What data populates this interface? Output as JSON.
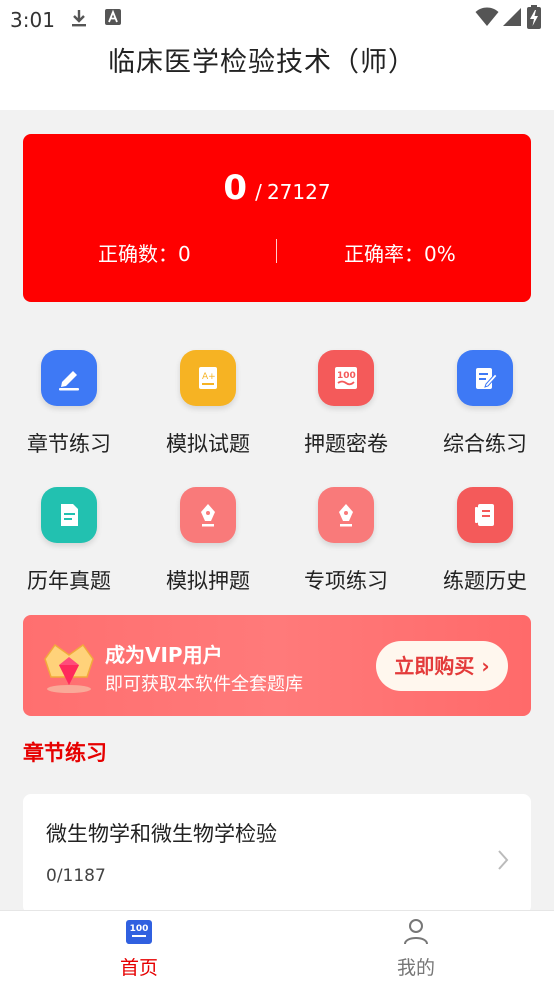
{
  "status_bar": {
    "time": "3:01"
  },
  "app_title": "临床医学检验技术（师）",
  "stats": {
    "done": "0",
    "separator": "/",
    "total": "27127",
    "correct_count_label": "正确数：0",
    "correct_rate_label": "正确率：0%"
  },
  "menu": [
    {
      "label": "章节练习",
      "icon": "pencil-ruler-icon",
      "color": "#3e79f5"
    },
    {
      "label": "模拟试题",
      "icon": "exam-paper-icon",
      "color": "#f6b323"
    },
    {
      "label": "押题密卷",
      "icon": "score-100-icon",
      "color": "#f45a5a"
    },
    {
      "label": "综合练习",
      "icon": "document-edit-icon",
      "color": "#3e79f5"
    },
    {
      "label": "历年真题",
      "icon": "document-icon",
      "color": "#22c1b0"
    },
    {
      "label": "模拟押题",
      "icon": "pen-nib-icon",
      "color": "#f97a7a"
    },
    {
      "label": "专项练习",
      "icon": "pen-nib-icon",
      "color": "#f97a7a"
    },
    {
      "label": "练题历史",
      "icon": "notebook-icon",
      "color": "#f45a5a"
    }
  ],
  "vip": {
    "title": "成为VIP用户",
    "subtitle": "即可获取本软件全套题库",
    "button": "立即购买"
  },
  "section_title": "章节练习",
  "chapter": {
    "name": "微生物学和微生物学检验",
    "progress": "0/1187"
  },
  "tabs": {
    "home": "首页",
    "home_badge": "100",
    "mine": "我的"
  }
}
